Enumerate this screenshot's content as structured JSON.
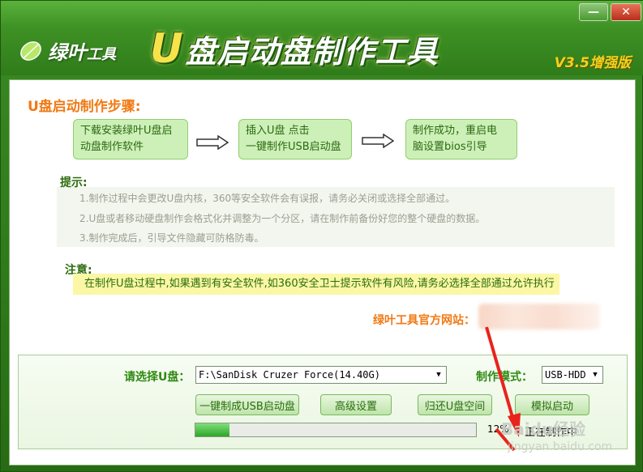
{
  "window": {
    "minimize_icon": "minimize-icon",
    "close_icon": "close-icon",
    "minimize_glyph": "—",
    "close_glyph": "✕"
  },
  "header": {
    "logo_text": "绿叶",
    "logo_text_small": "工具",
    "title_u": "U",
    "title_rest": "盘启动盘制作工具",
    "version": "V3.5增强版",
    "accent_color": "#f8e24a"
  },
  "steps": {
    "title": "U盘启动制作步骤:",
    "items": [
      {
        "line1": "下载安装绿叶U盘启",
        "line2": "动盘制作软件"
      },
      {
        "line1": "插入U盘 点击",
        "line2": "一键制作USB启动盘"
      },
      {
        "line1": "制作成功，重启电",
        "line2": "脑设置bios引导"
      }
    ]
  },
  "tips": {
    "title": "提示:",
    "items": [
      "1.制作过程中会更改U盘内核，360等安全软件会有误报，请务必关闭或选择全部通过。",
      "2.U盘或者移动硬盘制作会格式化并调整为一个分区，请在制作前备份好您的整个硬盘的数据。",
      "3.制作完成后，引导文件隐藏可防格防毒。"
    ]
  },
  "notice": {
    "title": "注意:",
    "text": "在制作U盘过程中,如果遇到有安全软件,如360安全卫士提示软件有风险,请务必选择全部通过允许执行"
  },
  "site": {
    "label": "绿叶工具官方网站："
  },
  "panel": {
    "usb_label": "请选择U盘：",
    "usb_value": "F:\\SanDisk Cruzer Force(14.40G)",
    "mode_label": "制作模式：",
    "mode_value": "USB-HDD",
    "buttons": {
      "make": "一键制成USB启动盘",
      "advanced": "高级设置",
      "restore": "归还U盘空间",
      "simulate": "模拟启动"
    },
    "progress_percent": 12,
    "progress_text": "12%",
    "status_text": "正在制作中"
  },
  "watermark": {
    "line1": "Baidu经验",
    "line2": "jingyan.baidu.com"
  }
}
